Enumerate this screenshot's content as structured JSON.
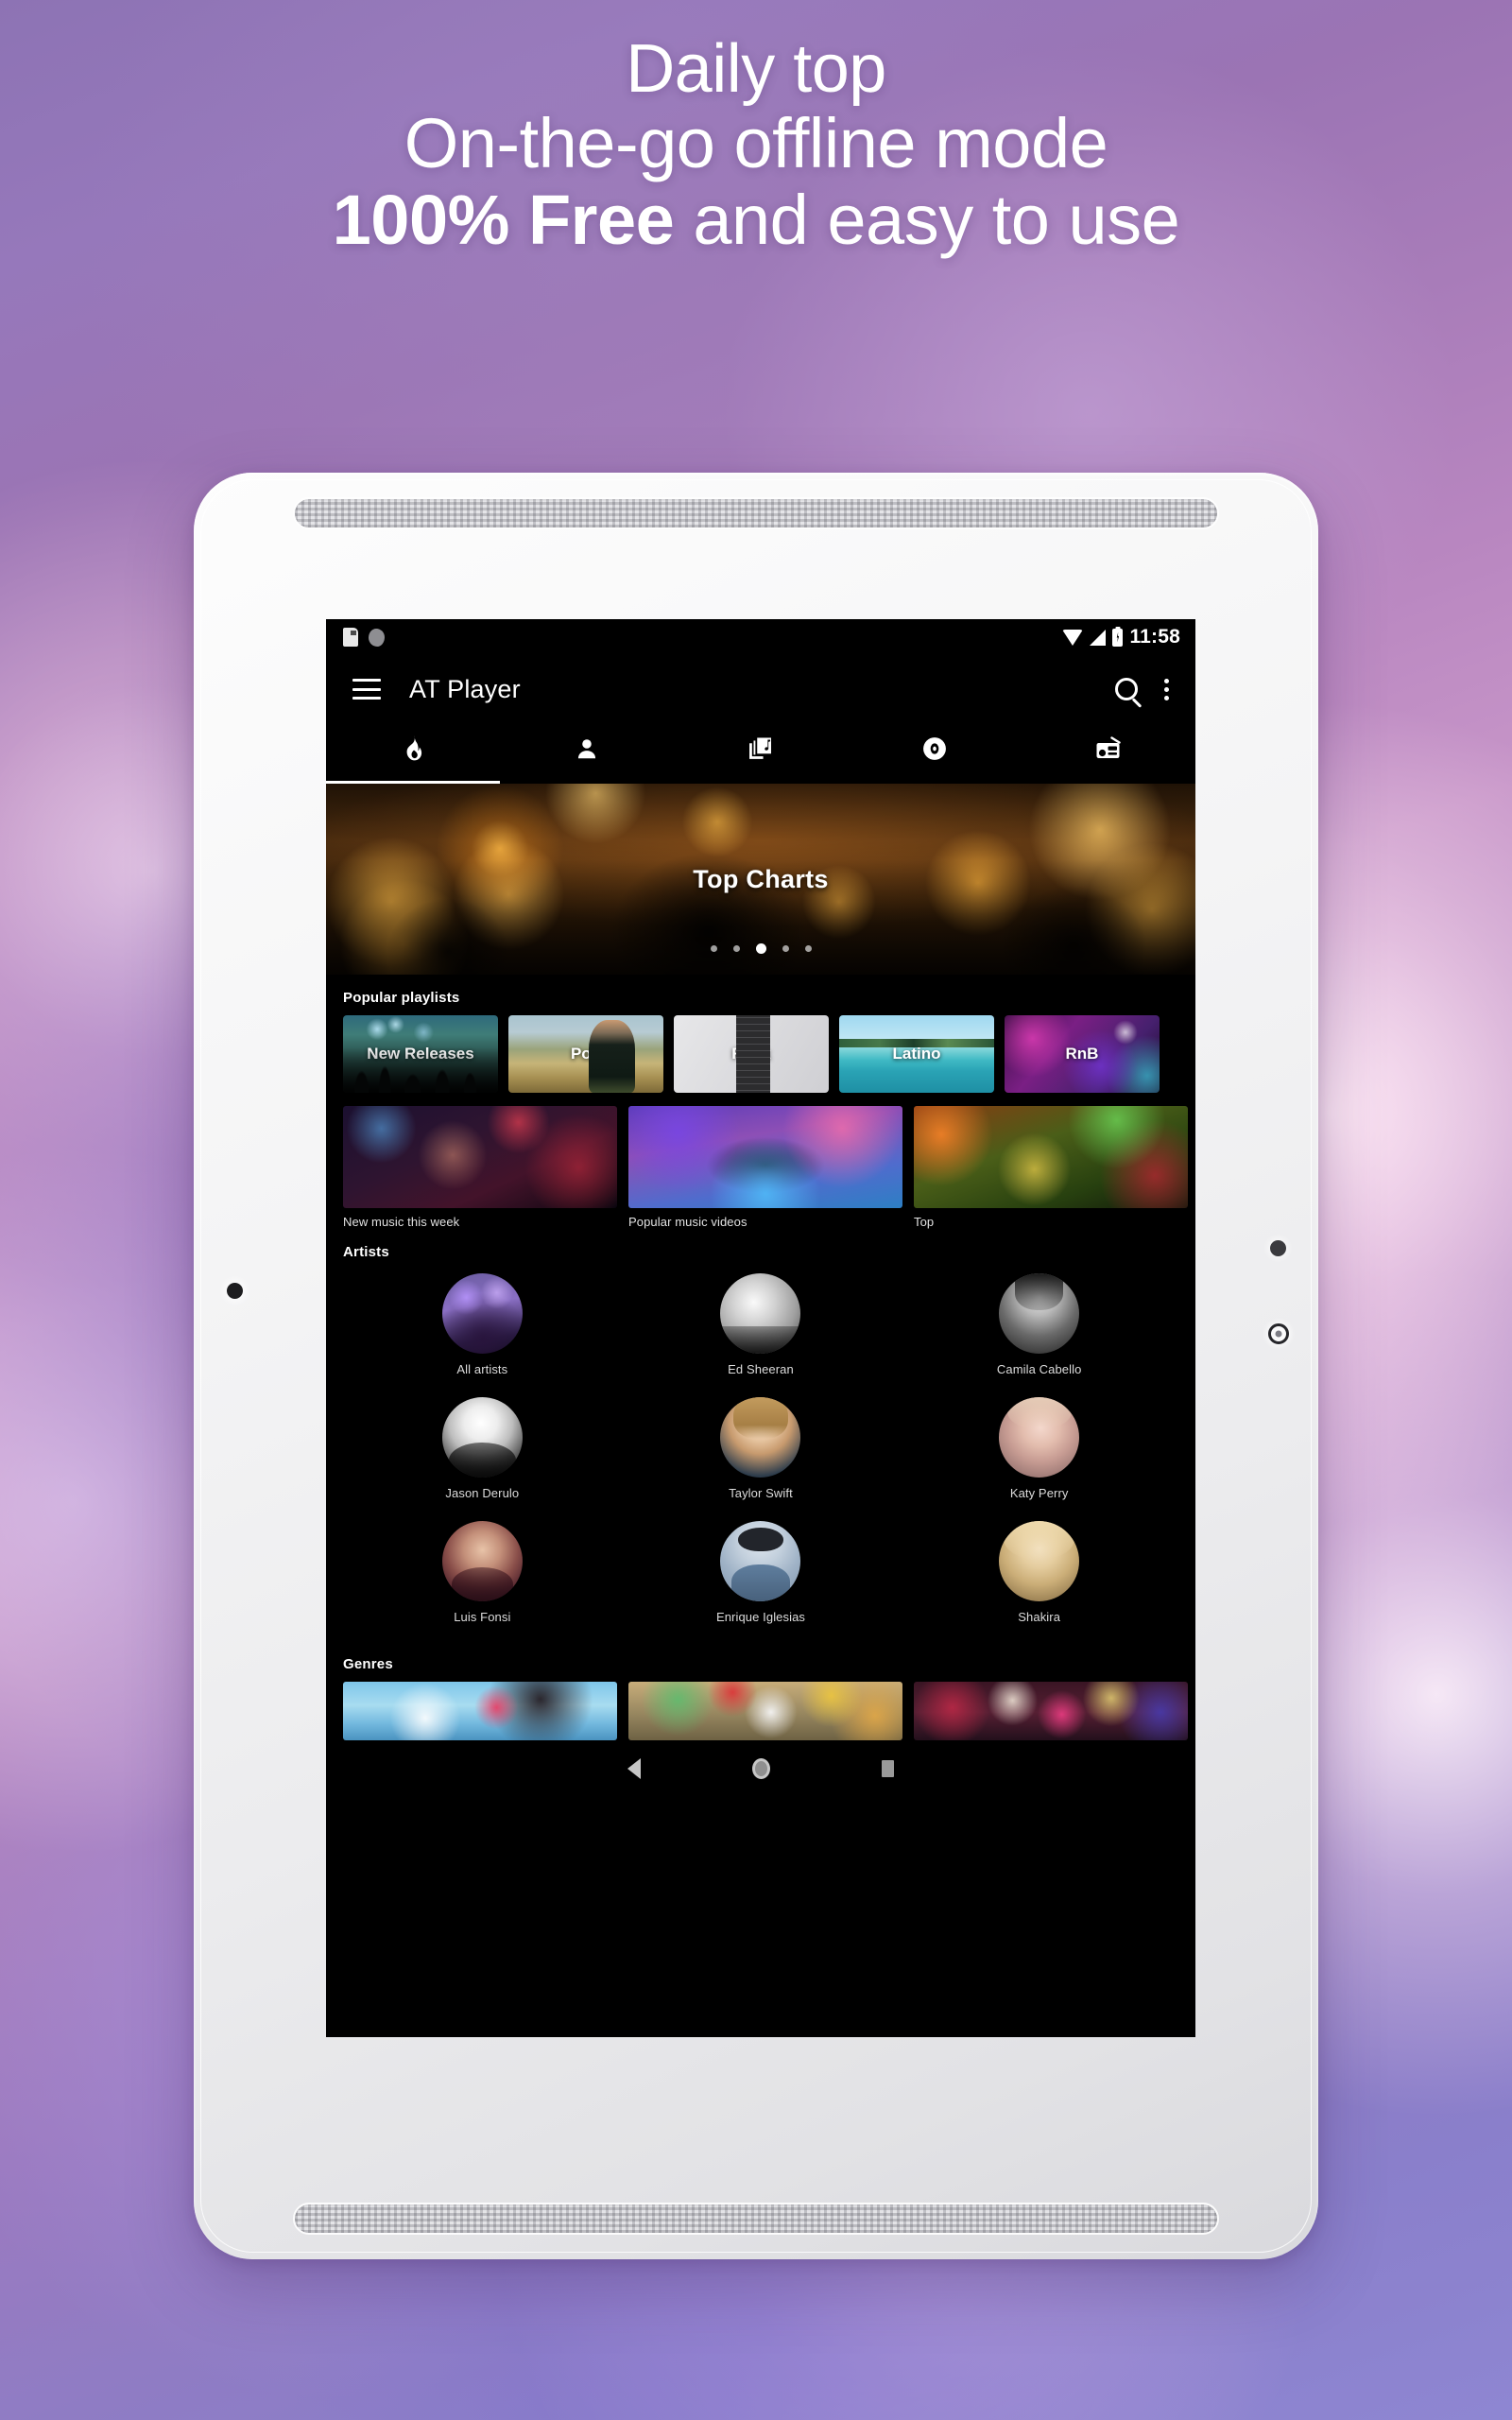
{
  "headline": {
    "line1": "Daily top",
    "line2": "On-the-go offline mode",
    "line3_strong": "100% Free",
    "line3_rest": " and easy to use"
  },
  "device": {
    "type": "white-android-tablet",
    "bezel_color": "#f2f2f4"
  },
  "status_bar": {
    "time": "11:58",
    "icons": [
      "sd-card-icon",
      "blob-icon",
      "wifi-icon",
      "signal-icon",
      "battery-charging-icon"
    ]
  },
  "toolbar": {
    "menu_icon": "hamburger-icon",
    "title": "AT Player",
    "search_icon": "search-icon",
    "overflow_icon": "kebab-menu-icon"
  },
  "tabs": [
    {
      "name": "trending",
      "icon": "flame-icon",
      "active": true
    },
    {
      "name": "artists",
      "icon": "person-icon",
      "active": false
    },
    {
      "name": "library",
      "icon": "music-library-icon",
      "active": false
    },
    {
      "name": "albums",
      "icon": "vinyl-disc-icon",
      "active": false
    },
    {
      "name": "radio",
      "icon": "radio-icon",
      "active": false
    }
  ],
  "hero": {
    "title": "Top Charts",
    "dot_count": 5,
    "active_dot": 2
  },
  "sections": {
    "playlists_title": "Popular playlists",
    "artists_title": "Artists",
    "genres_title": "Genres"
  },
  "playlists": [
    {
      "label": "New Releases",
      "theme": "pl-new"
    },
    {
      "label": "Pop",
      "theme": "pl-pop"
    },
    {
      "label": "Rock",
      "theme": "pl-rock"
    },
    {
      "label": "Latino",
      "theme": "pl-latino"
    },
    {
      "label": "RnB",
      "theme": "pl-rnb"
    }
  ],
  "videos": [
    {
      "caption": "New music this week",
      "theme": "vt-1"
    },
    {
      "caption": "Popular music videos",
      "theme": "vt-2"
    },
    {
      "caption": "Top",
      "theme": "vt-3"
    }
  ],
  "artists": [
    {
      "name": "All artists",
      "theme": "av-all"
    },
    {
      "name": "Ed Sheeran",
      "theme": "av-ed"
    },
    {
      "name": "Camila Cabello",
      "theme": "av-camila"
    },
    {
      "name": "Jason Derulo",
      "theme": "av-jason"
    },
    {
      "name": "Taylor Swift",
      "theme": "av-taylor"
    },
    {
      "name": "Katy Perry",
      "theme": "av-katy"
    },
    {
      "name": "Luis Fonsi",
      "theme": "av-luis"
    },
    {
      "name": "Enrique Iglesias",
      "theme": "av-enrique"
    },
    {
      "name": "Shakira",
      "theme": "av-shakira"
    }
  ],
  "genres": [
    {
      "theme": "gn-1"
    },
    {
      "theme": "gn-2"
    },
    {
      "theme": "gn-3"
    }
  ],
  "nav_bar": {
    "back_icon": "back-triangle-icon",
    "home_icon": "home-circle-icon",
    "recents_icon": "recents-square-icon"
  },
  "colors": {
    "screen_bg": "#000000",
    "text_primary": "#ffffff",
    "text_secondary": "#dcdcdc",
    "bg_purple": "#9b7ac0"
  }
}
